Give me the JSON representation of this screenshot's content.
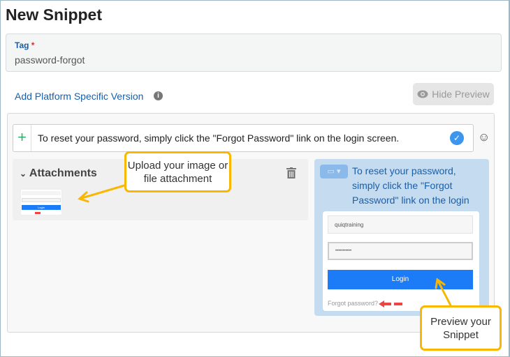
{
  "title": "New Snippet",
  "tag": {
    "label": "Tag",
    "required_mark": "*",
    "value": "password-forgot"
  },
  "add_platform_link": "Add Platform Specific Version",
  "info_icon": "i",
  "hide_preview_label": "Hide Preview",
  "editor": {
    "plus": "+",
    "text": "To reset your password, simply click the \"Forgot Password\" link on the login screen.",
    "check": "✓",
    "emoji": "☺"
  },
  "attachments": {
    "title": "Attachments",
    "chevron": "⌄",
    "trash": "🗑"
  },
  "preview": {
    "text": "To reset your password, simply click the \"Forgot Password\" link on the login screen.",
    "username": "quiqtraining",
    "password": "•••••••••••",
    "login": "Login",
    "forgot": "Forgot password?"
  },
  "thumb": {
    "login": "Login"
  },
  "callouts": {
    "upload": "Upload your image or file attachment",
    "preview": "Preview your Snippet"
  },
  "colors": {
    "accent": "#1a5ea8",
    "callout_border": "#f8b700",
    "login_button": "#1c7cf7",
    "preview_bg": "#c5dcf0"
  }
}
